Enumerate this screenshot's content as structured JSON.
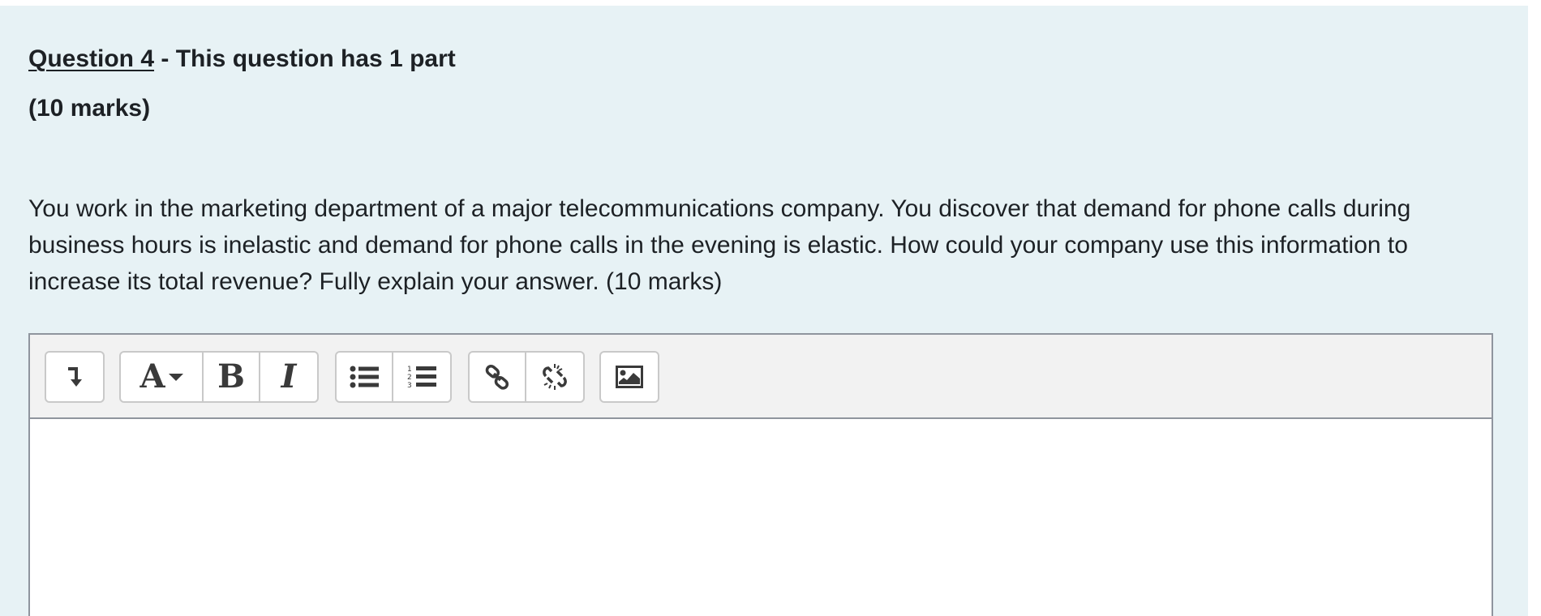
{
  "question": {
    "number_label": "Question 4",
    "title_suffix": " - This question has 1 part",
    "marks": "(10 marks)",
    "text_lines": [
      "You work in the marketing department of a major telecommunications company. You discover that demand for phone calls during",
      "business hours is inelastic and demand for phone calls in the evening is elastic.  How could your company use this information to",
      "increase its total revenue? Fully explain your answer.    (10 marks)"
    ]
  },
  "editor": {
    "toolbar": {
      "groups": [
        [
          "show-more-buttons-icon"
        ],
        [
          "paragraph-styles-icon",
          "bold-icon",
          "italic-icon"
        ],
        [
          "unordered-list-icon",
          "ordered-list-icon"
        ],
        [
          "link-icon",
          "unlink-icon"
        ],
        [
          "image-icon"
        ]
      ],
      "bold_glyph": "B",
      "italic_glyph": "I",
      "styles_glyph": "A"
    },
    "content": ""
  },
  "colors": {
    "panel_background": "#e7f2f5",
    "text": "#1d2125",
    "toolbar_background": "#f2f2f2",
    "editor_border": "#8f959e"
  }
}
